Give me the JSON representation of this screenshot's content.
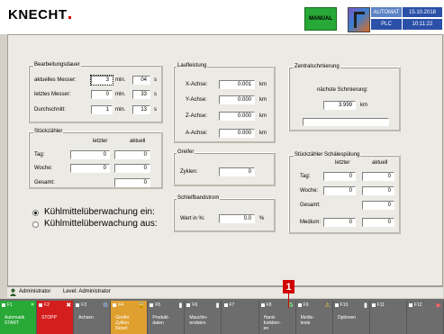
{
  "header": {
    "logo": "KNECHT",
    "mode_button": "MANUAL",
    "status_auto": "AUTOMAT",
    "status_plc": "PLC",
    "date": "15.10.2018",
    "time": "10:11:22"
  },
  "bearbeitung": {
    "title": "Bearbeitungsdauer",
    "rows": [
      {
        "label": "aktuelles Messer:",
        "min": "3",
        "min_unit": "min.",
        "sec": "04",
        "sec_unit": "s"
      },
      {
        "label": "letztes Messer:",
        "min": "0",
        "min_unit": "min.",
        "sec": "33",
        "sec_unit": "s"
      },
      {
        "label": "Durchschnitt:",
        "min": "1",
        "min_unit": "min.",
        "sec": "13",
        "sec_unit": "s"
      }
    ]
  },
  "stueckzaehler": {
    "title": "Stückzähler",
    "col_last": "letzter",
    "col_current": "aktuell",
    "rows": [
      {
        "label": "Tag:",
        "last": "0",
        "current": "0"
      },
      {
        "label": "Woche:",
        "last": "0",
        "current": "0"
      },
      {
        "label": "Gesamt:",
        "current": "0"
      }
    ]
  },
  "coolant": {
    "option_on": "Kühlmittelüberwachung ein:",
    "option_off": "Kühlmittelüberwachung aus:"
  },
  "laufleistung": {
    "title": "Laufleistung",
    "rows": [
      {
        "label": "X-Achse:",
        "value": "0.001",
        "unit": "km"
      },
      {
        "label": "Y-Achse:",
        "value": "0.000",
        "unit": "km"
      },
      {
        "label": "Z-Achse:",
        "value": "0.000",
        "unit": "km"
      },
      {
        "label": "A-Achse:",
        "value": "0.000",
        "unit": "km"
      }
    ]
  },
  "greifer": {
    "title": "Greifer",
    "label": "Zyklen:",
    "value": "0"
  },
  "schleifband": {
    "title": "Schleifbandstrom",
    "label": "Wert in %:",
    "value": "0.0",
    "unit": "%"
  },
  "zentral": {
    "title": "Zentralschmierung",
    "label": "nächste Schmierung:",
    "value": "3.999",
    "unit": "km",
    "progress": 0
  },
  "schaele": {
    "title": "Stückzähler Schälespülung",
    "col_last": "letzter",
    "col_current": "aktuell",
    "rows": [
      {
        "label": "Tag:",
        "last": "0",
        "current": "0"
      },
      {
        "label": "Woche:",
        "last": "0",
        "current": "0"
      },
      {
        "label": "Gesamt:",
        "current": "0"
      },
      {
        "label": "Medium:",
        "last": "0",
        "current": "0"
      }
    ]
  },
  "user": {
    "name": "Administrator",
    "level": "Level: Administrator"
  },
  "callout": "1",
  "fkeys": [
    {
      "num": "F1",
      "label": "Automatik\nSTART",
      "bg": "#28a837"
    },
    {
      "num": "F2",
      "label": "STOPP",
      "bg": "#d41e1e"
    },
    {
      "num": "F3",
      "label": "Achsen",
      "bg": "#6d6d6d"
    },
    {
      "num": "F4",
      "label": "Greifer\nZyklen\nReset",
      "bg": "#e0a030"
    },
    {
      "num": "F5",
      "label": "Produkt-\ndaten",
      "bg": "#6d6d6d"
    },
    {
      "num": "F6",
      "label": "Maschin-\nendaten",
      "bg": "#6d6d6d"
    },
    {
      "num": "F7",
      "label": "",
      "bg": "#6d6d6d"
    },
    {
      "num": "F8",
      "label": "Hand-\nfunktion-\nen",
      "bg": "#6d6d6d"
    },
    {
      "num": "F9",
      "label": "Melde-\ntexte",
      "bg": "#6d6d6d"
    },
    {
      "num": "F10",
      "label": "Optionen",
      "bg": "#6d6d6d"
    },
    {
      "num": "F11",
      "label": "",
      "bg": "#6d6d6d"
    },
    {
      "num": "F12",
      "label": "",
      "bg": "#6d6d6d"
    }
  ]
}
